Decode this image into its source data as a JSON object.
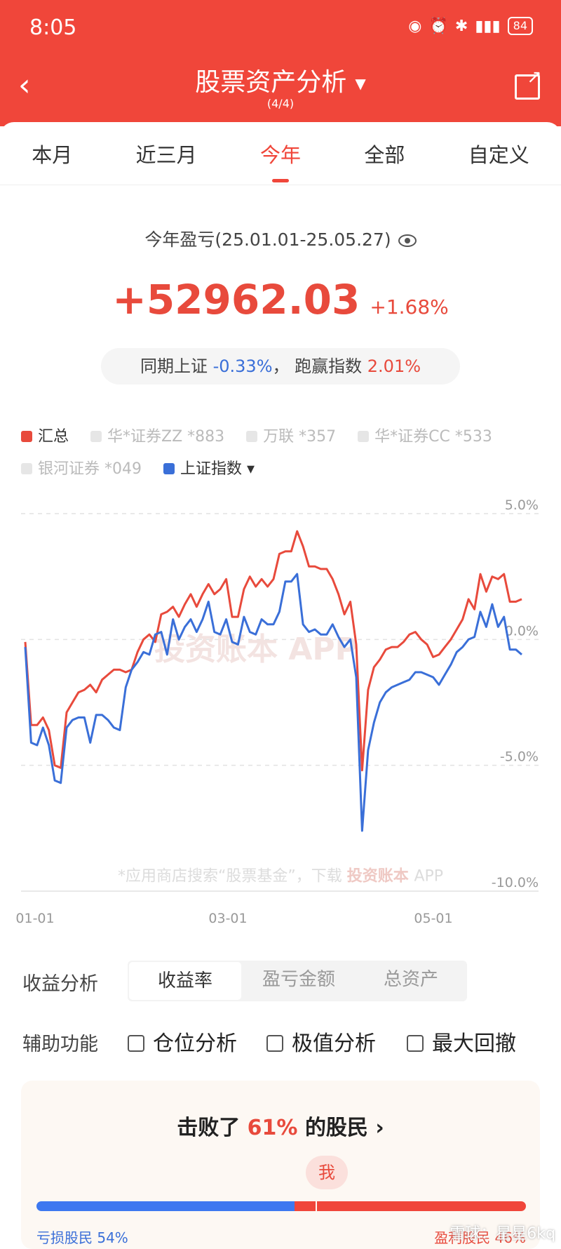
{
  "status": {
    "time": "8:05",
    "battery": "84",
    "icons": [
      "eye-icon",
      "alarm-icon",
      "bluetooth-icon",
      "vibrate-icon",
      "signal-5g-icon",
      "signal-5g-icon"
    ]
  },
  "nav": {
    "title": "股票资产分析",
    "subtitle": "(4/4)"
  },
  "tabs": [
    "本月",
    "近三月",
    "今年",
    "全部",
    "自定义"
  ],
  "active_tab": 2,
  "summary": {
    "period": "今年盈亏(25.01.01-25.05.27)",
    "amount": "+52962.03",
    "percent": "+1.68%",
    "compare_label": "同期上证",
    "compare_value": "-0.33%",
    "sep": "，",
    "beat_label": "跑赢指数",
    "beat_value": "2.01%"
  },
  "legend": [
    {
      "label": "汇总",
      "on": true,
      "color": "#e84a3c"
    },
    {
      "label": "华*证券ZZ *883",
      "on": false
    },
    {
      "label": "万联 *357",
      "on": false
    },
    {
      "label": "华*证券CC *533",
      "on": false
    },
    {
      "label": "银河证券 *049",
      "on": false
    },
    {
      "label": "上证指数 ▾",
      "on": true,
      "color": "#3a6fd8"
    }
  ],
  "chart_data": {
    "type": "line",
    "x_ticks": [
      "01-01",
      "03-01",
      "05-01"
    ],
    "y_ticks": [
      "5.0%",
      "0.0%",
      "-5.0%",
      "-10.0%"
    ],
    "ylim": [
      -10,
      5
    ],
    "watermark": "投资账本 APP",
    "footer_note": "*应用商店搜索“股票基金”，下载",
    "footer_brand": "投资账本",
    "footer_app": "APP",
    "series": [
      {
        "name": "汇总",
        "color": "#e84a3c",
        "values": [
          -0.1,
          -3.4,
          -3.4,
          -3.1,
          -3.6,
          -5.0,
          -5.1,
          -2.9,
          -2.5,
          -2.1,
          -2.0,
          -1.8,
          -2.1,
          -1.6,
          -1.4,
          -1.2,
          -1.2,
          -1.3,
          -1.2,
          -0.5,
          0.0,
          0.2,
          -0.1,
          1.0,
          1.1,
          1.3,
          0.9,
          1.4,
          1.8,
          1.3,
          1.8,
          2.2,
          1.8,
          2.0,
          2.4,
          0.9,
          0.9,
          2.0,
          2.5,
          2.1,
          2.4,
          2.1,
          2.4,
          3.4,
          3.5,
          3.5,
          4.3,
          3.7,
          2.9,
          2.9,
          2.8,
          2.8,
          2.4,
          1.8,
          1.0,
          1.5,
          -0.2,
          -5.2,
          -2.0,
          -1.1,
          -0.8,
          -0.4,
          -0.3,
          -0.3,
          -0.1,
          0.2,
          0.3,
          0.0,
          -0.2,
          -0.7,
          -0.6,
          -0.3,
          0.0,
          0.4,
          0.8,
          1.6,
          1.2,
          2.6,
          1.9,
          2.5,
          2.4,
          2.6,
          1.5,
          1.5,
          1.6
        ]
      },
      {
        "name": "上证指数",
        "color": "#3a6fd8",
        "values": [
          -0.3,
          -4.1,
          -4.2,
          -3.5,
          -4.2,
          -5.6,
          -5.7,
          -3.5,
          -3.2,
          -3.1,
          -3.1,
          -4.1,
          -3.0,
          -3.0,
          -3.2,
          -3.5,
          -3.6,
          -1.9,
          -1.2,
          -0.9,
          -0.5,
          -0.6,
          0.2,
          0.3,
          -0.6,
          0.8,
          0.0,
          0.5,
          0.8,
          0.3,
          0.8,
          1.5,
          0.3,
          0.2,
          0.8,
          -0.1,
          -0.2,
          0.9,
          0.3,
          0.2,
          0.8,
          0.6,
          0.6,
          1.1,
          2.3,
          2.3,
          2.6,
          0.6,
          0.3,
          0.4,
          0.2,
          0.2,
          0.6,
          0.1,
          -0.3,
          0.0,
          -1.5,
          -7.6,
          -4.4,
          -3.3,
          -2.5,
          -2.1,
          -1.9,
          -1.8,
          -1.7,
          -1.6,
          -1.3,
          -1.3,
          -1.4,
          -1.5,
          -1.8,
          -1.4,
          -1.0,
          -0.5,
          -0.3,
          0.0,
          0.1,
          1.1,
          0.5,
          1.4,
          0.5,
          0.9,
          -0.4,
          -0.4,
          -0.6
        ]
      }
    ]
  },
  "metric_tabs": {
    "label": "收益分析",
    "options": [
      "收益率",
      "盈亏金额",
      "总资产"
    ],
    "active": 0
  },
  "aux": {
    "label": "辅助功能",
    "options": [
      "仓位分析",
      "极值分析",
      "最大回撤"
    ]
  },
  "rank": {
    "prefix": "击败了",
    "percent": "61%",
    "suffix": "的股民",
    "arrow": "›",
    "me": "我",
    "loss_label": "亏损股民 54%",
    "gain_label": "盈利股民 46%"
  },
  "footer_watermark": "雪球：星星6kq"
}
